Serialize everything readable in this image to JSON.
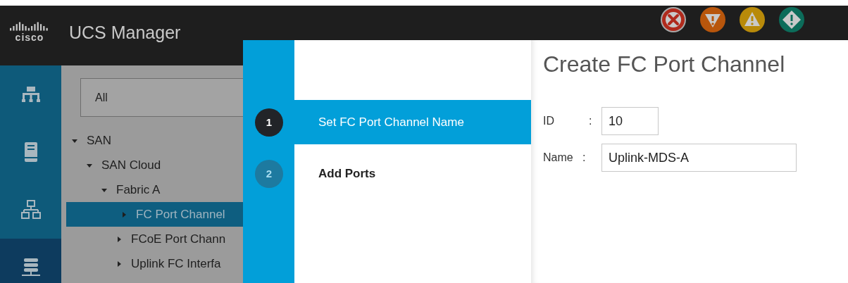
{
  "header": {
    "logo_text": "cisco",
    "title": "UCS Manager"
  },
  "nav_rail": [
    {
      "kind": "topology",
      "selected": false
    },
    {
      "kind": "server",
      "selected": false
    },
    {
      "kind": "network",
      "selected": false
    },
    {
      "kind": "storage",
      "selected": true
    }
  ],
  "filter": {
    "value": "All"
  },
  "tree": [
    {
      "label": "SAN",
      "expanded": true,
      "selected": false,
      "children": [
        {
          "label": "SAN Cloud",
          "expanded": true,
          "selected": false,
          "children": [
            {
              "label": "Fabric A",
              "expanded": true,
              "selected": false,
              "children": [
                {
                  "label": "FC Port Channel",
                  "expanded": false,
                  "selected": true
                },
                {
                  "label": "FCoE Port Chann",
                  "expanded": false,
                  "selected": false
                },
                {
                  "label": "Uplink FC Interfa",
                  "expanded": false,
                  "selected": false
                }
              ]
            }
          ]
        }
      ]
    }
  ],
  "wizard": {
    "title": "Create FC Port Channel",
    "steps": [
      {
        "number": "1",
        "label": "Set FC Port Channel Name",
        "selected": true
      },
      {
        "number": "2",
        "label": "Add Ports",
        "selected": false
      }
    ],
    "fields": [
      {
        "label": "ID",
        "separator": ":",
        "value": "10",
        "kind": "short"
      },
      {
        "label": "Name",
        "separator": ":",
        "value": "Uplink-MDS-A",
        "kind": "long"
      }
    ]
  }
}
